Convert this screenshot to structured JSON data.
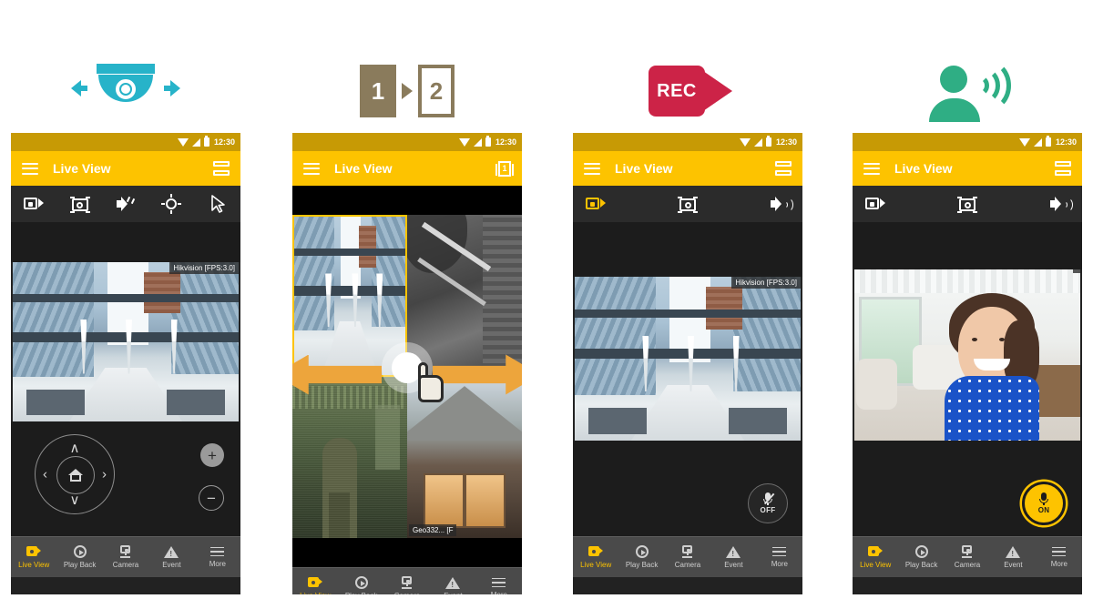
{
  "panels": [
    {
      "id": "ptz",
      "top_icon": {
        "name": "ptz-camera-icon",
        "color": "#27b3c9",
        "caption": ""
      },
      "status_bar": {
        "time": "12:30",
        "icons": [
          "wifi-icon",
          "signal-icon",
          "battery-icon"
        ]
      },
      "appbar": {
        "menu_icon": "hamburger-icon",
        "title": "Live View",
        "right_icon": "layout-2x-icon",
        "right_label": ""
      },
      "toolbar": [
        {
          "name": "record-icon",
          "label": "Record",
          "active": false
        },
        {
          "name": "snapshot-icon",
          "label": "Snapshot",
          "active": false
        },
        {
          "name": "speaker-mute-icon",
          "label": "Audio Off",
          "active": false
        },
        {
          "name": "ptz-target-icon",
          "label": "PTZ",
          "active": false
        },
        {
          "name": "cursor-arrow-icon",
          "label": "Pointer",
          "active": false
        }
      ],
      "video": {
        "label": "Hikvision [FPS:3.0]",
        "scene": "building-plaza"
      },
      "ptz_controls": {
        "up": "∧",
        "down": "∨",
        "left": "‹",
        "right": "›",
        "home": "home-icon",
        "zoom_in": "+",
        "zoom_out": "−"
      }
    },
    {
      "id": "multiview",
      "top_icon": {
        "name": "page-swipe-icon",
        "page_from": "1",
        "page_to": "2",
        "color": "#8a7b5c"
      },
      "status_bar": {
        "time": "12:30",
        "icons": [
          "wifi-icon",
          "signal-icon",
          "battery-icon"
        ]
      },
      "appbar": {
        "menu_icon": "hamburger-icon",
        "title": "Live View",
        "right_icon": "layout-1x-icon",
        "right_label": "1"
      },
      "grid": [
        {
          "label": "",
          "scene": "building-plaza",
          "selected": true
        },
        {
          "label": "",
          "scene": "stairs-bw",
          "selected": false
        },
        {
          "label": "",
          "scene": "corridor-night-green",
          "selected": false
        },
        {
          "label": "Geo332... [F",
          "scene": "house-window",
          "selected": false
        }
      ],
      "gesture": {
        "name": "swipe-left-right-gesture",
        "left_arrow": "←",
        "right_arrow": "→"
      }
    },
    {
      "id": "recording",
      "top_icon": {
        "name": "rec-video-icon",
        "text": "REC",
        "color": "#cc2347"
      },
      "status_bar": {
        "time": "12:30",
        "icons": [
          "wifi-icon",
          "signal-icon",
          "battery-icon"
        ]
      },
      "appbar": {
        "menu_icon": "hamburger-icon",
        "title": "Live View",
        "right_icon": "layout-2x-icon",
        "right_label": ""
      },
      "toolbar": [
        {
          "name": "record-icon",
          "label": "Record",
          "active": true
        },
        {
          "name": "snapshot-icon",
          "label": "Snapshot",
          "active": false
        },
        {
          "name": "speaker-on-icon",
          "label": "Audio On",
          "active": false
        }
      ],
      "video": {
        "label": "Hikvision [FPS:3.0]",
        "scene": "building-plaza"
      },
      "mic_button": {
        "name": "two-way-audio-toggle",
        "state_label": "OFF",
        "glyph": "mic-muted-icon",
        "active": false
      }
    },
    {
      "id": "twoway-audio",
      "top_icon": {
        "name": "person-talking-icon",
        "color": "#2fae84"
      },
      "status_bar": {
        "time": "12:30",
        "icons": [
          "wifi-icon",
          "signal-icon",
          "battery-icon"
        ]
      },
      "appbar": {
        "menu_icon": "hamburger-icon",
        "title": "Live View",
        "right_icon": "layout-2x-icon",
        "right_label": ""
      },
      "toolbar": [
        {
          "name": "record-icon",
          "label": "Record",
          "active": false
        },
        {
          "name": "snapshot-icon",
          "label": "Snapshot",
          "active": false
        },
        {
          "name": "speaker-on-icon",
          "label": "Audio On",
          "active": false
        }
      ],
      "video": {
        "label": "",
        "scene": "child-indoor"
      },
      "mic_button": {
        "name": "two-way-audio-toggle",
        "state_label": "ON",
        "glyph": "mic-icon",
        "active": true
      }
    }
  ],
  "bottom_nav": [
    {
      "icon": "live-view-icon",
      "label": "Live View",
      "active": true
    },
    {
      "icon": "playback-icon",
      "label": "Play Back",
      "active": false
    },
    {
      "icon": "camera-icon",
      "label": "Camera",
      "active": false
    },
    {
      "icon": "event-icon",
      "label": "Event",
      "active": false
    },
    {
      "icon": "more-icon",
      "label": "More",
      "active": false
    }
  ],
  "colors": {
    "accent_yellow": "#fdc300",
    "status_bar_yellow": "#c79a05",
    "toolbar_dark": "#2b2b2b",
    "nav_grey": "#4a4a4a",
    "rec_red": "#cc2347",
    "talk_green": "#2fae84",
    "camera_cyan": "#27b3c9",
    "page_brown": "#8a7b5c",
    "arrow_orange": "#eda53c"
  }
}
